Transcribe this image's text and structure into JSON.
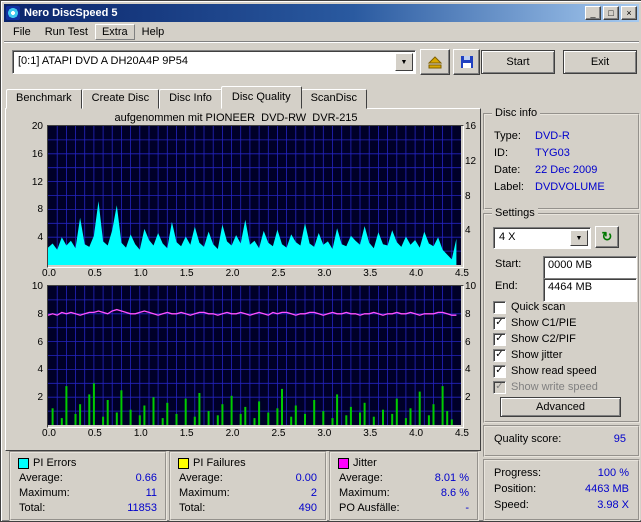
{
  "window": {
    "title": "Nero DiscSpeed 5",
    "menu": [
      "File",
      "Run Test",
      "Extra",
      "Help"
    ]
  },
  "icons": {
    "dropdown_arrow": "▼",
    "check": "✓",
    "refresh": "↻",
    "minimize": "_",
    "maximize": "□",
    "close": "×"
  },
  "toolbar": {
    "drive_select": "[0:1]  ATAPI DVD A  DH20A4P 9P54",
    "start": "Start",
    "exit": "Exit"
  },
  "tabs": [
    "Benchmark",
    "Create Disc",
    "Disc Info",
    "Disc Quality",
    "ScanDisc"
  ],
  "active_tab": "Disc Quality",
  "chart_data": [
    {
      "type": "area",
      "title": "aufgenommen mit PIONEER  DVD-RW  DVR-215",
      "bg": "#000028",
      "grid_color": "#2424c0",
      "grid_x_step": 0.1,
      "grid_y_step": 2,
      "x_start": 0.0,
      "x_step": 0.05,
      "xlim": [
        0,
        4.5
      ],
      "ylim": [
        0,
        20
      ],
      "ylim_right": [
        0,
        16
      ],
      "yticks_left": [
        4,
        8,
        12,
        16,
        20
      ],
      "yticks_right": [
        4,
        8,
        12,
        16
      ],
      "xticks": [
        "0.0",
        "0.5",
        "1.0",
        "1.5",
        "2.0",
        "2.5",
        "3.0",
        "3.5",
        "4.0",
        "4.5"
      ],
      "series": [
        {
          "name": "PI Errors",
          "type": "area",
          "color": "#00ffff",
          "values": [
            2.5,
            3.1,
            2.2,
            4.0,
            2.8,
            3.5,
            2.4,
            6.8,
            3.0,
            2.6,
            4.2,
            9.2,
            3.4,
            2.8,
            5.0,
            8.6,
            3.2,
            2.5,
            4.4,
            3.0,
            2.2,
            5.2,
            3.6,
            2.8,
            4.6,
            3.1,
            2.4,
            6.2,
            3.3,
            2.7,
            4.1,
            2.9,
            5.5,
            3.2,
            2.6,
            4.8,
            3.0,
            2.3,
            5.8,
            3.4,
            2.8,
            4.3,
            3.1,
            6.5,
            2.9,
            3.5,
            2.4,
            4.9,
            3.2,
            2.7,
            5.1,
            3.0,
            2.5,
            4.4,
            3.3,
            2.8,
            6.0,
            3.1,
            2.6,
            4.6,
            2.9,
            3.4,
            2.3,
            5.3,
            3.0,
            2.7,
            4.2,
            3.5,
            2.9,
            5.6,
            3.2,
            2.4,
            4.7,
            3.0,
            2.8,
            5.0,
            3.3,
            2.6,
            4.1,
            2.9,
            3.6,
            2.5,
            4.8,
            3.1,
            2.7,
            4.0,
            2.2,
            1.5,
            0.8,
            3.8
          ]
        }
      ]
    },
    {
      "type": "bar+line",
      "title": "",
      "bg": "#000028",
      "grid_color": "#2424c0",
      "grid_x_step": 0.1,
      "grid_y_step": 1,
      "x_start": 0.0,
      "x_step": 0.05,
      "xlim": [
        0,
        4.5
      ],
      "ylim": [
        0,
        10
      ],
      "ylim_right": [
        0,
        10
      ],
      "yticks_left": [
        2,
        4,
        6,
        8,
        10
      ],
      "yticks_right": [
        2,
        4,
        6,
        8,
        10
      ],
      "xticks": [
        "0.0",
        "0.5",
        "1.0",
        "1.5",
        "2.0",
        "2.5",
        "3.0",
        "3.5",
        "4.0",
        "4.5"
      ],
      "series": [
        {
          "name": "PI Failures",
          "type": "bar",
          "color": "#00cc00",
          "values": [
            0,
            1.2,
            0,
            0.5,
            2.8,
            0,
            0.8,
            1.5,
            0,
            2.2,
            3.0,
            0,
            0.6,
            1.8,
            0,
            0.9,
            2.5,
            0,
            1.1,
            0,
            0.7,
            1.4,
            0,
            2.0,
            0,
            0.5,
            1.6,
            0,
            0.8,
            0,
            1.9,
            0,
            0.6,
            2.3,
            0,
            1.0,
            0,
            0.7,
            1.5,
            0,
            2.1,
            0,
            0.8,
            1.3,
            0,
            0.5,
            1.7,
            0,
            0.9,
            0,
            1.2,
            2.6,
            0,
            0.6,
            1.4,
            0,
            0.8,
            0,
            1.8,
            0,
            1.0,
            0,
            0.5,
            2.2,
            0,
            0.7,
            1.3,
            0,
            0.9,
            1.6,
            0,
            0.6,
            0,
            1.1,
            0,
            0.8,
            1.9,
            0,
            0.5,
            1.2,
            0,
            2.4,
            0,
            0.7,
            1.5,
            0,
            2.8,
            1.0,
            0.4,
            0
          ]
        },
        {
          "name": "Jitter",
          "type": "line",
          "color": "#ff50ff",
          "values": [
            7.9,
            8.0,
            7.9,
            8.1,
            8.0,
            8.1,
            8.0,
            7.9,
            8.0,
            8.1,
            8.1,
            8.2,
            8.1,
            8.0,
            8.2,
            8.3,
            8.2,
            8.1,
            8.0,
            8.0,
            8.1,
            8.2,
            8.1,
            8.0,
            7.9,
            8.0,
            8.1,
            8.0,
            8.0,
            8.1,
            8.0,
            7.9,
            8.0,
            8.1,
            8.1,
            8.0,
            8.0,
            7.9,
            8.0,
            8.1,
            8.0,
            8.0,
            8.1,
            8.0,
            7.9,
            8.0,
            8.1,
            8.0,
            7.9,
            8.1,
            8.0,
            8.1,
            8.1,
            8.0,
            7.9,
            8.0,
            8.0,
            8.1,
            8.1,
            8.0,
            7.9,
            8.0,
            8.1,
            8.0,
            8.0,
            8.1,
            8.0,
            8.0,
            7.9,
            8.0,
            8.0,
            8.1,
            8.0,
            7.9,
            8.0,
            8.0,
            8.1,
            8.0,
            8.0,
            8.1,
            8.0,
            7.9,
            8.0,
            8.0,
            8.0,
            8.1,
            8.1,
            8.0,
            7.9,
            7.9
          ]
        }
      ]
    }
  ],
  "disc_info": {
    "title": "Disc info",
    "rows": [
      {
        "label": "Type:",
        "value": "DVD-R"
      },
      {
        "label": "ID:",
        "value": "TYG03"
      },
      {
        "label": "Date:",
        "value": "22 Dec 2009"
      },
      {
        "label": "Label:",
        "value": "DVDVOLUME"
      }
    ]
  },
  "settings": {
    "title": "Settings",
    "speed": "4 X",
    "start_label": "Start:",
    "start_value": "0000 MB",
    "end_label": "End:",
    "end_value": "4464 MB",
    "checkboxes": [
      {
        "label": "Quick scan",
        "checked": false,
        "disabled": false
      },
      {
        "label": "Show C1/PIE",
        "checked": true,
        "disabled": false
      },
      {
        "label": "Show C2/PIF",
        "checked": true,
        "disabled": false
      },
      {
        "label": "Show jitter",
        "checked": true,
        "disabled": false
      },
      {
        "label": "Show read speed",
        "checked": true,
        "disabled": false
      },
      {
        "label": "Show write speed",
        "checked": true,
        "disabled": true
      }
    ],
    "advanced": "Advanced"
  },
  "quality": {
    "label": "Quality score:",
    "value": "95"
  },
  "progress": {
    "rows": [
      {
        "label": "Progress:",
        "value": "100 %"
      },
      {
        "label": "Position:",
        "value": "4463 MB"
      },
      {
        "label": "Speed:",
        "value": "3.98 X"
      }
    ]
  },
  "stats": [
    {
      "name": "PI Errors",
      "swatch": "#00ffff",
      "rows": [
        {
          "label": "Average:",
          "value": "0.66"
        },
        {
          "label": "Maximum:",
          "value": "11"
        },
        {
          "label": "Total:",
          "value": "11853"
        }
      ]
    },
    {
      "name": "PI Failures",
      "swatch": "#ffff00",
      "rows": [
        {
          "label": "Average:",
          "value": "0.00"
        },
        {
          "label": "Maximum:",
          "value": "2"
        },
        {
          "label": "Total:",
          "value": "490"
        }
      ]
    },
    {
      "name": "Jitter",
      "swatch": "#ff00ff",
      "rows": [
        {
          "label": "Average:",
          "value": "8.01 %"
        },
        {
          "label": "Maximum:",
          "value": "8.6 %"
        },
        {
          "label": "PO Ausfälle:",
          "value": "-"
        }
      ]
    }
  ]
}
